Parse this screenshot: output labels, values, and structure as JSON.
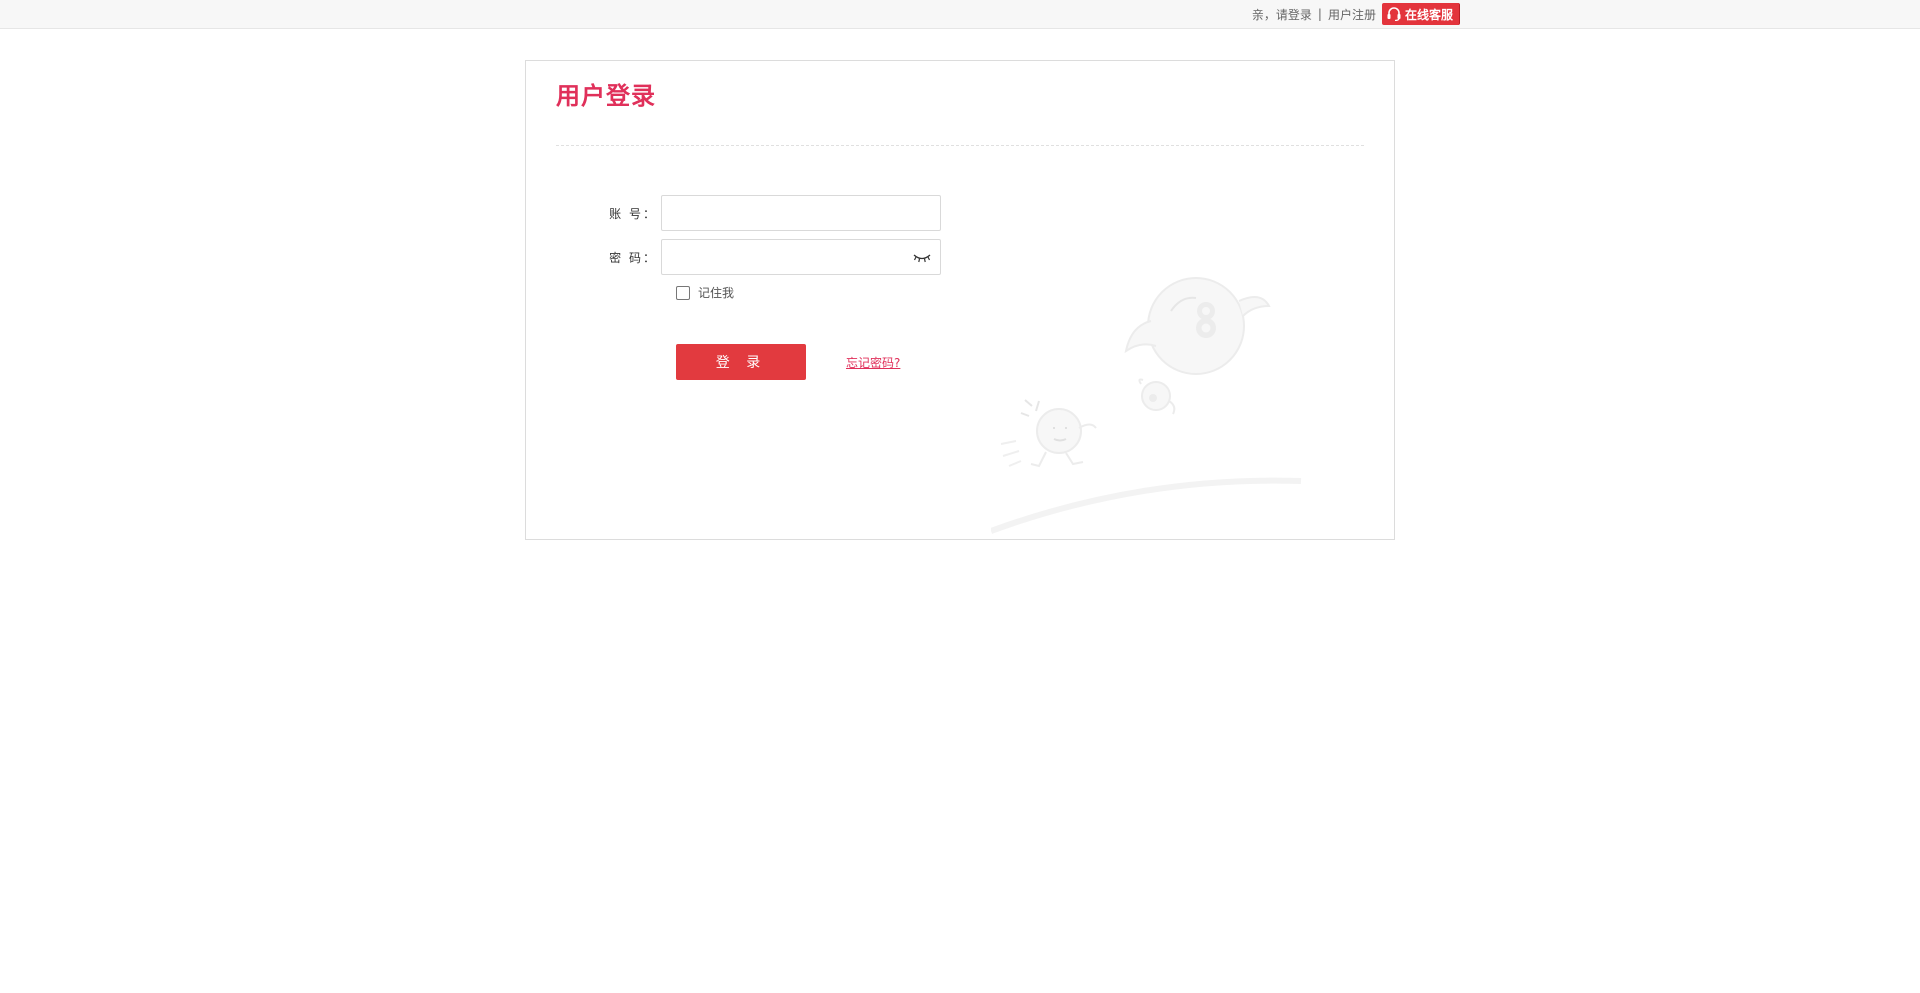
{
  "topbar": {
    "greeting": "亲，请登录",
    "separator": "|",
    "register": "用户注册",
    "service": "在线客服"
  },
  "card": {
    "title": "用户登录"
  },
  "form": {
    "account_label": "账 号：",
    "account_value": "",
    "password_label": "密 码：",
    "password_value": "",
    "remember_label": "记住我",
    "remember_checked": false,
    "login_button": "登 录",
    "forgot_link": "忘记密码?"
  },
  "colors": {
    "accent": "#e0305a",
    "button": "#e23a3f",
    "service": "#e3343c"
  },
  "icons": {
    "service": "headset-icon",
    "password_toggle": "eye-closed-icon",
    "illustration": "mascot-illustration"
  }
}
